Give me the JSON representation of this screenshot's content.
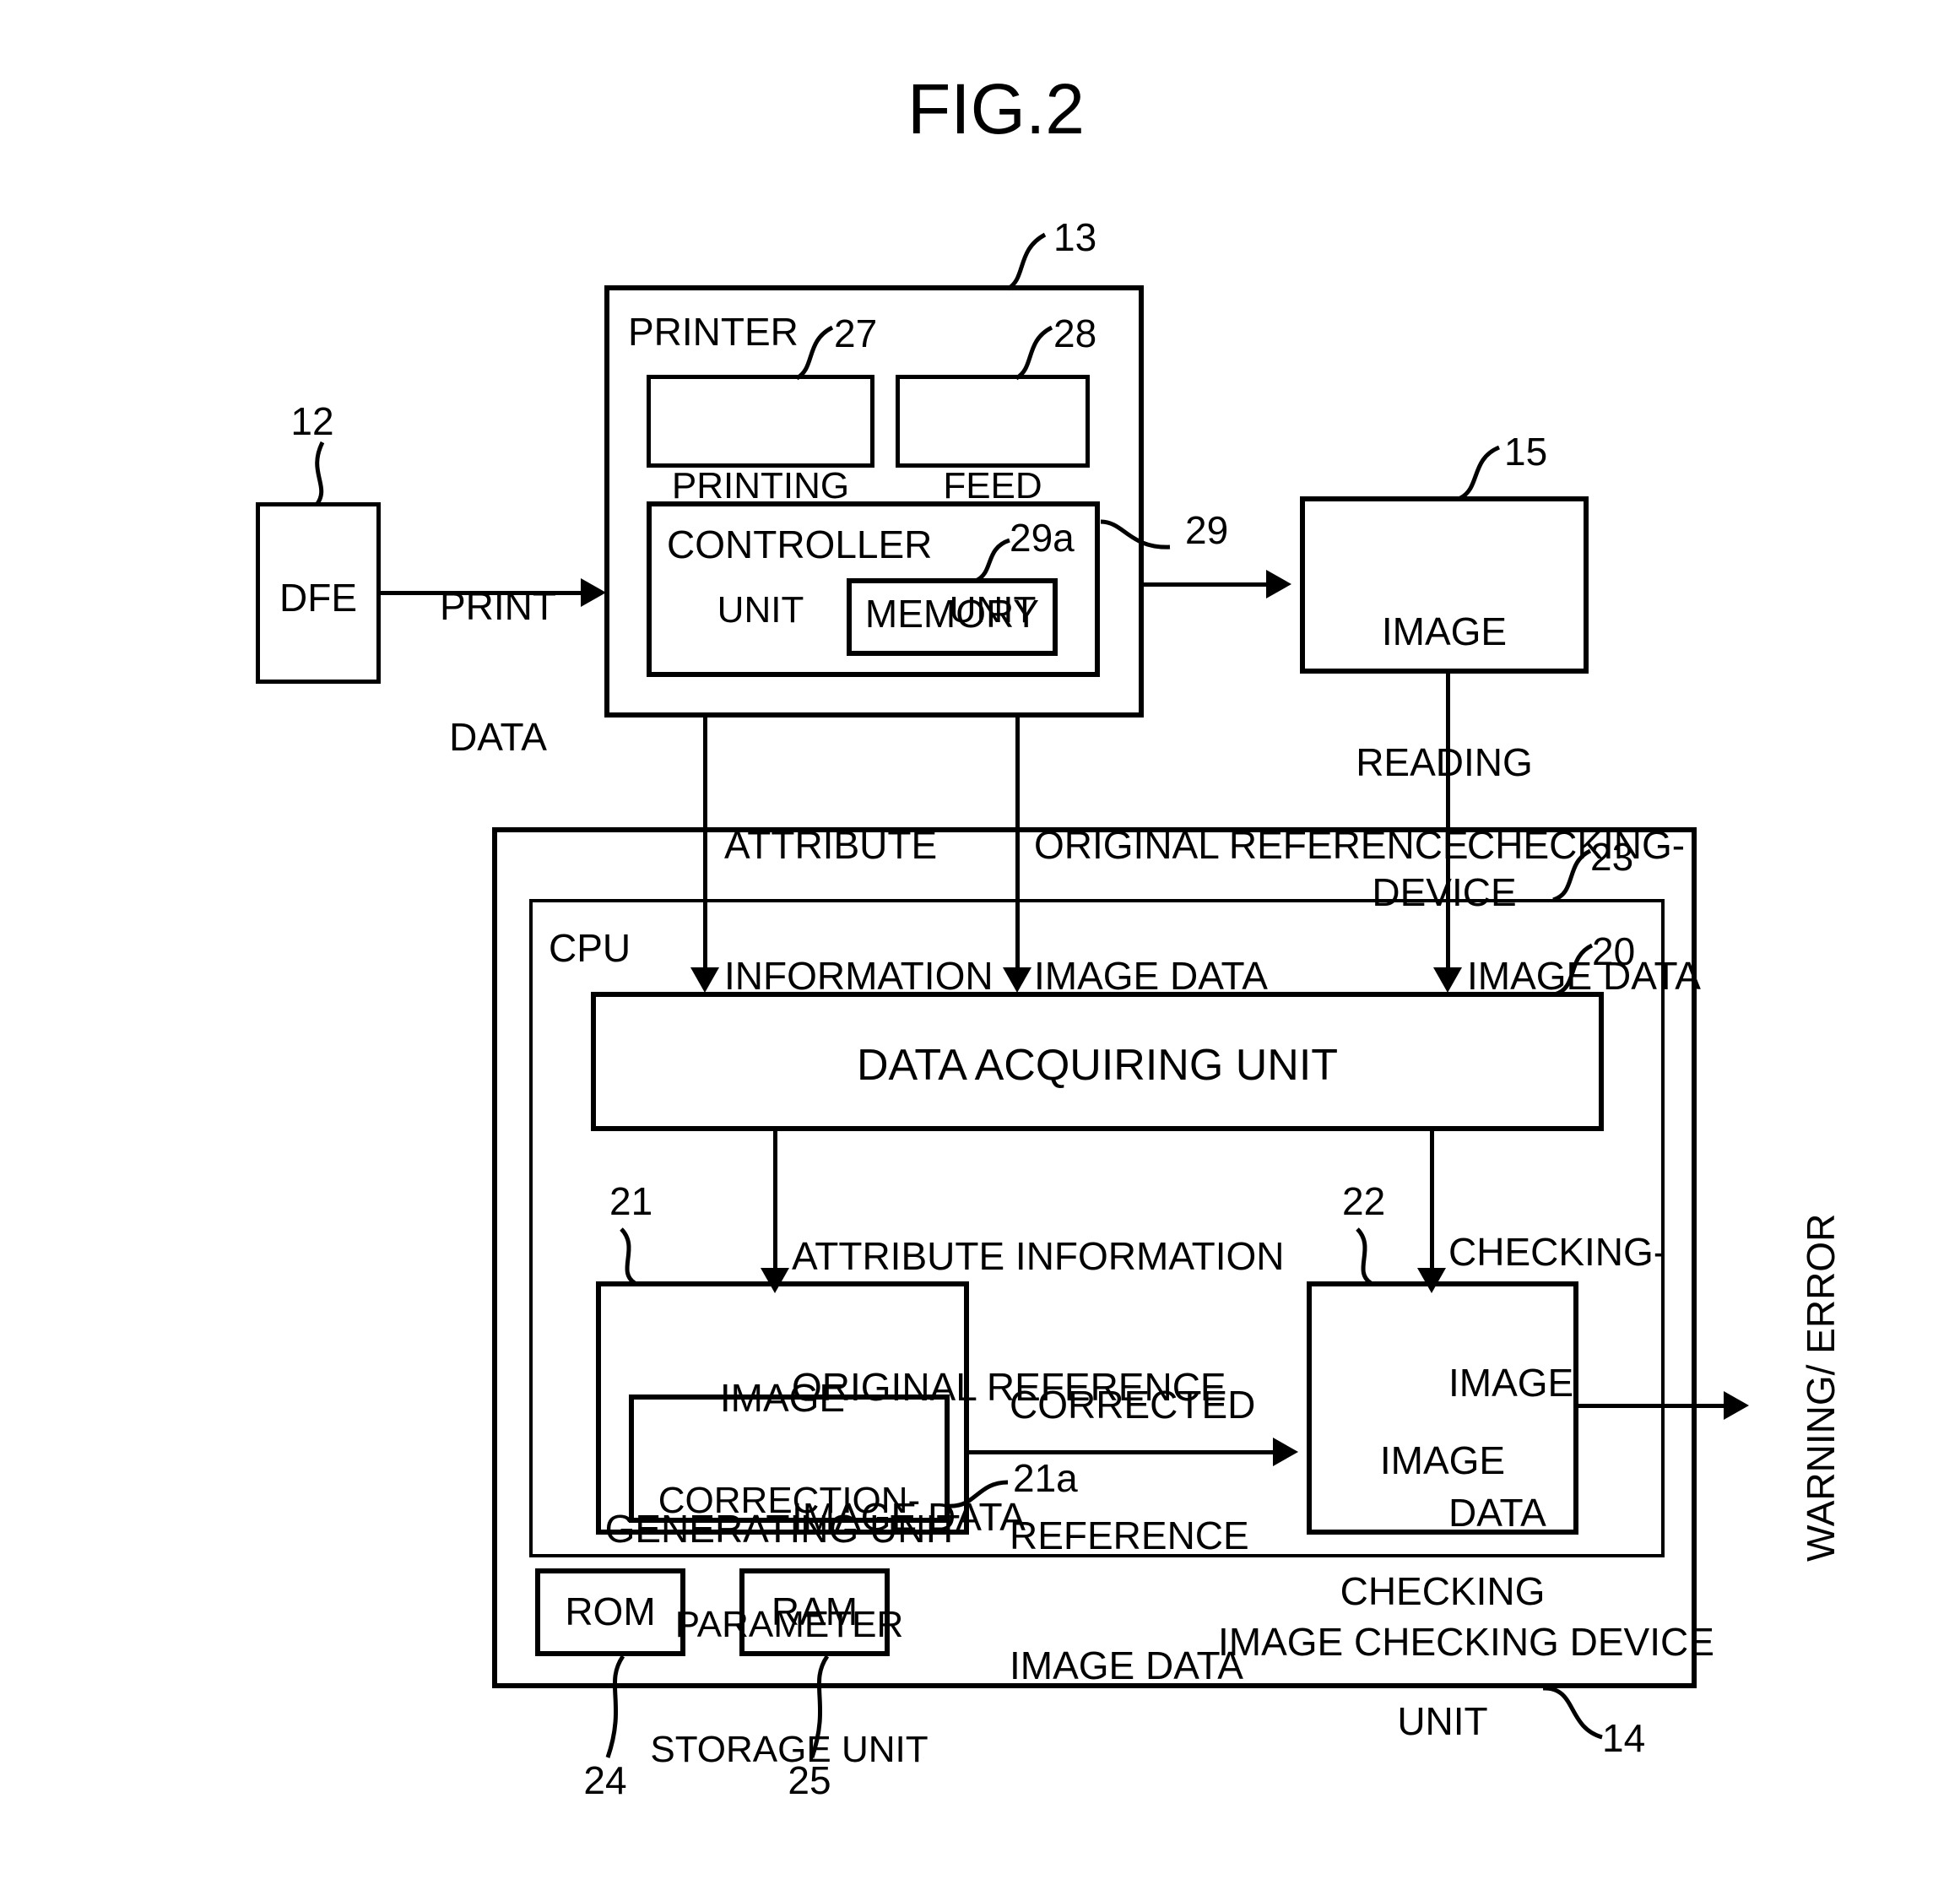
{
  "figure": {
    "title": "FIG.2",
    "blocks": {
      "dfe": {
        "label": "DFE",
        "ref": "12"
      },
      "printer": {
        "label": "PRINTER",
        "ref": "13"
      },
      "printing_unit": {
        "label_line1": "PRINTING",
        "label_line2": "UNIT",
        "ref": "27"
      },
      "feed_unit": {
        "label_line1": "FEED",
        "label_line2": "UNIT",
        "ref": "28"
      },
      "controller": {
        "label": "CONTROLLER",
        "ref": "29"
      },
      "memory": {
        "label": "MEMORY",
        "ref": "29a"
      },
      "image_reading_device": {
        "label_line1": "IMAGE",
        "label_line2": "READING",
        "label_line3": "DEVICE",
        "ref": "15"
      },
      "image_checking_device": {
        "label": "IMAGE CHECKING DEVICE",
        "ref": "14"
      },
      "cpu": {
        "label": "CPU",
        "ref": "23"
      },
      "data_acquiring_unit": {
        "label": "DATA ACQUIRING UNIT",
        "ref": "20"
      },
      "image_generating_unit": {
        "label_line1": "IMAGE",
        "label_line2": "GENERATING UNIT",
        "ref": "21"
      },
      "correction_parameter_storage_unit": {
        "label_line1": "CORRECTION-",
        "label_line2": "PARAMETER",
        "label_line3": "STORAGE UNIT",
        "ref": "21a"
      },
      "image_checking_unit": {
        "label_line1": "IMAGE",
        "label_line2": "CHECKING",
        "label_line3": "UNIT",
        "ref": "22"
      },
      "rom": {
        "label": "ROM",
        "ref": "24"
      },
      "ram": {
        "label": "RAM",
        "ref": "25"
      }
    },
    "flow_labels": {
      "print_data": {
        "line1": "PRINT",
        "line2": "DATA"
      },
      "attribute_information": {
        "line1": "ATTRIBUTE",
        "line2": "INFORMATION"
      },
      "original_reference_image_data": {
        "line1": "ORIGINAL REFERENCE",
        "line2": "IMAGE DATA"
      },
      "checking_image_data_top": {
        "line1": "CHECKING-",
        "line2": "IMAGE DATA"
      },
      "attr_and_original_mid": {
        "line1": "ATTRIBUTE INFORMATION",
        "line2": "ORIGINAL REFERENCE",
        "line3": "IMAGE DATA"
      },
      "checking_image_data_mid": {
        "line1": "CHECKING-",
        "line2": "IMAGE",
        "line3": "DATA"
      },
      "corrected_reference_image_data": {
        "line1": "CORRECTED",
        "line2": "REFERENCE",
        "line3": "IMAGE DATA"
      },
      "warning_error": "WARNING/ ERROR"
    }
  }
}
